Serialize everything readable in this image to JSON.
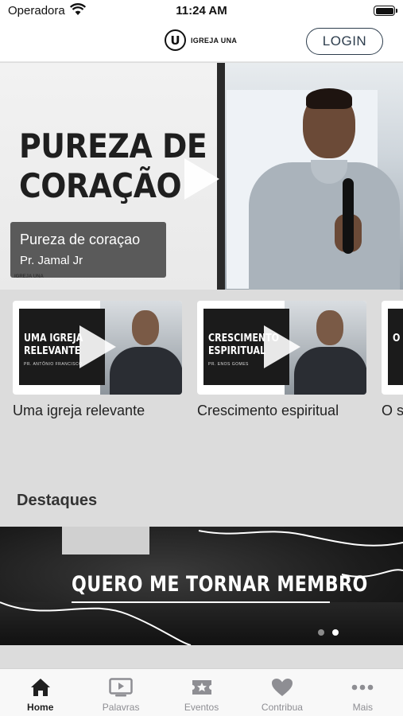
{
  "status_bar": {
    "carrier": "Operadora",
    "time": "11:24 AM"
  },
  "header": {
    "logo_text": "IGREJA UNA",
    "logo_letter": "U",
    "login_label": "LOGIN"
  },
  "hero": {
    "title_line1": "PUREZA DE",
    "title_line2": "CORAÇÃO",
    "video_title": "Pureza de coraçao",
    "speaker": "Pr. Jamal Jr",
    "brand": "IGREJA UNA"
  },
  "videos": [
    {
      "board_line1": "UMA IGREJA",
      "board_line2": "RELEVANTE",
      "board_sub": "PR. ANTÔNIO FRANCISCO",
      "title": "Uma igreja relevante"
    },
    {
      "board_line1": "CRESCIMENTO",
      "board_line2": "ESPIRITUAL",
      "board_sub": "PR. ENOS GOMES",
      "title": "Crescimento espiritual"
    },
    {
      "board_line1": "O",
      "board_line2": "",
      "board_sub": "",
      "title": "O s"
    }
  ],
  "section_title": "Destaques",
  "banner": {
    "title": "QUERO ME TORNAR MEMBRO",
    "dots": 2,
    "active_dot": 1
  },
  "tabs": [
    {
      "label": "Home",
      "icon": "home-icon",
      "active": true
    },
    {
      "label": "Palavras",
      "icon": "play-screen-icon",
      "active": false
    },
    {
      "label": "Eventos",
      "icon": "ticket-star-icon",
      "active": false
    },
    {
      "label": "Contribua",
      "icon": "heart-icon",
      "active": false
    },
    {
      "label": "Mais",
      "icon": "more-dots-icon",
      "active": false
    }
  ],
  "colors": {
    "accent": "#2d3d4d",
    "tab_active": "#1f1f1f",
    "tab_inactive": "#8e8e93"
  }
}
